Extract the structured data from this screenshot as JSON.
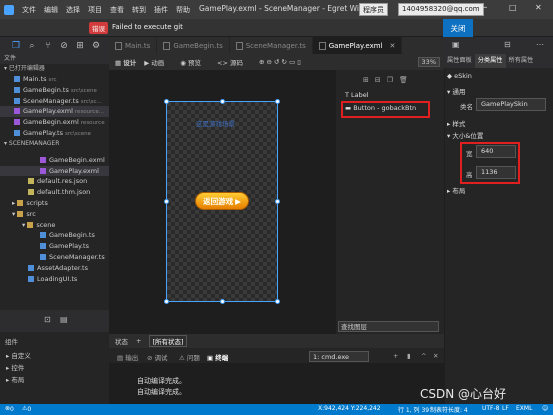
{
  "titlebar": {
    "menu": [
      "文件",
      "编辑",
      "选择",
      "项目",
      "查看",
      "转到",
      "插件",
      "帮助"
    ],
    "window_title": "GamePlay.exml - SceneManager - Egret Wing",
    "role_select": "程序员",
    "account": "1404958320@qq.com"
  },
  "errorbar": {
    "badge": "错误",
    "message": "Failed to execute git",
    "close_label": "关闭"
  },
  "tabs": [
    {
      "label": "Main.ts",
      "active": false
    },
    {
      "label": "GameBegin.ts",
      "active": false
    },
    {
      "label": "SceneManager.ts",
      "active": false
    },
    {
      "label": "GamePlay.exml",
      "active": true
    }
  ],
  "explorer": {
    "section_files": "文件",
    "section_open": "已打开编辑器",
    "open_editors": [
      {
        "name": "Main.ts",
        "path": "src"
      },
      {
        "name": "GameBegin.ts",
        "path": "src\\scene"
      },
      {
        "name": "SceneManager.ts",
        "path": "src\\sc..."
      },
      {
        "name": "GamePlay.exml",
        "path": "resource..."
      },
      {
        "name": "GameBegin.exml",
        "path": "resource"
      },
      {
        "name": "GamePlay.ts",
        "path": "src\\scene"
      }
    ],
    "section_project": "SCENEMANAGER",
    "tree": [
      {
        "name": "GameBegin.exml",
        "type": "exml",
        "indent": 3
      },
      {
        "name": "GamePlay.exml",
        "type": "exml",
        "indent": 3
      },
      {
        "name": "default.res.json",
        "type": "json",
        "indent": 2
      },
      {
        "name": "default.thm.json",
        "type": "json",
        "indent": 2
      },
      {
        "name": "scripts",
        "type": "folder",
        "indent": 1
      },
      {
        "name": "src",
        "type": "folder",
        "indent": 1
      },
      {
        "name": "scene",
        "type": "folder",
        "indent": 2
      },
      {
        "name": "GameBegin.ts",
        "type": "ts",
        "indent": 3
      },
      {
        "name": "GamePlay.ts",
        "type": "ts",
        "indent": 3
      },
      {
        "name": "SceneManager.ts",
        "type": "ts",
        "indent": 3
      },
      {
        "name": "AssetAdapter.ts",
        "type": "ts",
        "indent": 2
      },
      {
        "name": "LoadingUI.ts",
        "type": "ts",
        "indent": 2
      }
    ],
    "outline_title": "组件",
    "outline_items": [
      "自定义",
      "控件",
      "布局"
    ]
  },
  "editor_toolbar": {
    "items": [
      "设计",
      "动画",
      "预览",
      "源码"
    ],
    "zoom": "33%"
  },
  "canvas": {
    "label_text": "这是游戏场景",
    "button_text": "返回游戏"
  },
  "layers": {
    "items": [
      "Label",
      "Button - gobackBtn"
    ],
    "search_placeholder": "查找图层"
  },
  "properties": {
    "tabs": [
      "属性面板",
      "分类属性",
      "所有属性"
    ],
    "skin": "eSkin",
    "section_common": "通用",
    "class_label": "类名",
    "class_value": "GamePlaySkin",
    "section_style": "样式",
    "section_size": "大小&位置",
    "width_label": "宽",
    "width_value": "640",
    "height_label": "高",
    "height_value": "1136",
    "section_layout": "布局"
  },
  "console": {
    "tabs": [
      "状态",
      "+",
      "[所有状态]"
    ],
    "header_items": [
      "输出",
      "调试",
      "问题",
      "终端"
    ],
    "terminal_select": "1: cmd.exe",
    "lines": [
      "自动编译完成。",
      "自动编译完成。"
    ]
  },
  "status": {
    "left_counts": [
      "0",
      "0"
    ],
    "position": "X:942,424 Y:224,242",
    "line_col": "行 1, 列 39",
    "tab_size": "制表符长度: 4",
    "encoding": "UTF-8",
    "eol": "LF",
    "language": "EXML"
  },
  "watermark": "CSDN @心台好"
}
